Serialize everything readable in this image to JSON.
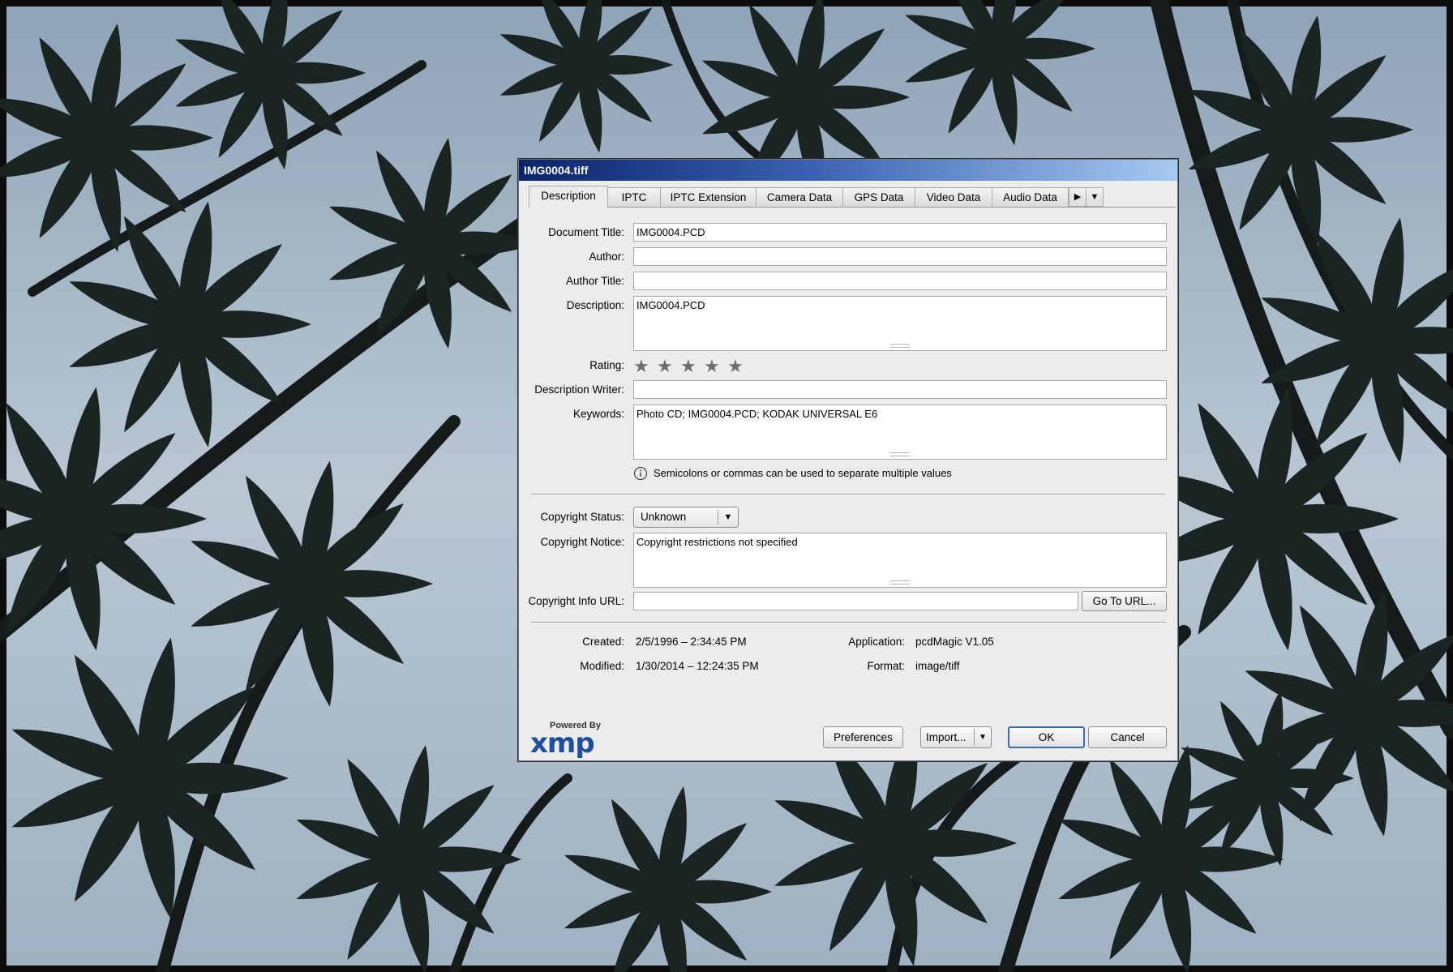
{
  "window": {
    "title": "IMG0004.tiff"
  },
  "tabs": [
    "Description",
    "IPTC",
    "IPTC Extension",
    "Camera Data",
    "GPS Data",
    "Video Data",
    "Audio Data"
  ],
  "fields": {
    "document_title": {
      "label": "Document Title:",
      "value": "IMG0004.PCD"
    },
    "author": {
      "label": "Author:",
      "value": ""
    },
    "author_title": {
      "label": "Author Title:",
      "value": ""
    },
    "description": {
      "label": "Description:",
      "value": "IMG0004.PCD"
    },
    "rating": {
      "label": "Rating:",
      "value": 0,
      "max": 5
    },
    "description_writer": {
      "label": "Description Writer:",
      "value": ""
    },
    "keywords": {
      "label": "Keywords:",
      "value": "Photo CD; IMG0004.PCD; KODAK UNIVERSAL E6"
    }
  },
  "hint": "Semicolons or commas can be used to separate multiple values",
  "copyright": {
    "status_label": "Copyright Status:",
    "status_value": "Unknown",
    "notice_label": "Copyright Notice:",
    "notice_value": "Copyright restrictions not specified",
    "url_label": "Copyright Info URL:",
    "url_value": "",
    "goto_label": "Go To URL..."
  },
  "file_info": {
    "created_label": "Created:",
    "created_value": "2/5/1996 – 2:34:45 PM",
    "modified_label": "Modified:",
    "modified_value": "1/30/2014 – 12:24:35 PM",
    "application_label": "Application:",
    "application_value": "pcdMagic V1.05",
    "format_label": "Format:",
    "format_value": "image/tiff"
  },
  "footer": {
    "powered_by": "Powered By",
    "xmp_logo": "xmp",
    "preferences": "Preferences",
    "import": "Import...",
    "ok": "OK",
    "cancel": "Cancel"
  },
  "colors": {
    "titlebar_start": "#0a246a",
    "titlebar_end": "#a6caf0",
    "default_button_border": "#3d6bb3"
  },
  "icons": [
    "info-icon",
    "dropdown-arrow-icon",
    "tab-scroll-right-icon",
    "tab-menu-icon",
    "star-icon"
  ]
}
